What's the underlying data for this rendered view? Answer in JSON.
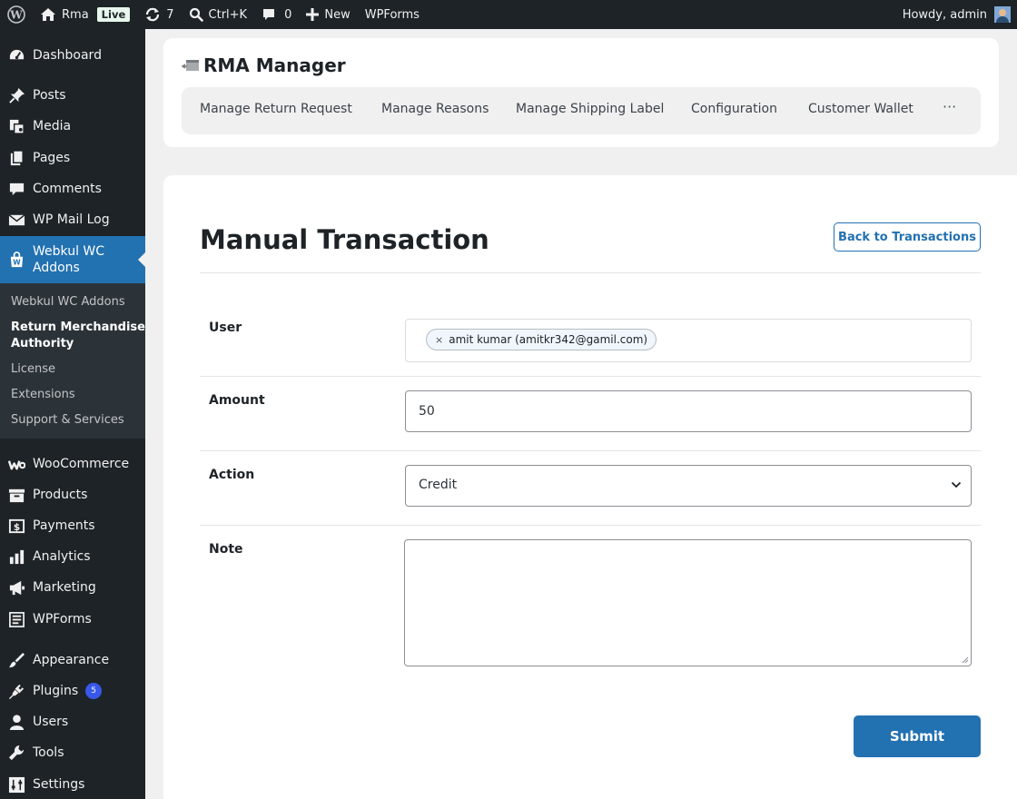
{
  "admin_bar": {
    "site_name": "Rma",
    "live_label": "Live",
    "updates_count": "7",
    "search_shortcut": "Ctrl+K",
    "comments_count": "0",
    "new_label": "New",
    "wpforms_label": "WPForms",
    "greeting": "Howdy, admin"
  },
  "sidebar": {
    "dashboard": "Dashboard",
    "posts": "Posts",
    "media": "Media",
    "pages": "Pages",
    "comments": "Comments",
    "wp_mail_log": "WP Mail Log",
    "webkul_line1": "Webkul WC",
    "webkul_line2": "Addons",
    "submenu": {
      "webkul_wc_addons": "Webkul WC Addons",
      "rma_line1": "Return Merchandise",
      "rma_line2": "Authority",
      "license": "License",
      "extensions": "Extensions",
      "support": "Support & Services"
    },
    "woocommerce": "WooCommerce",
    "products": "Products",
    "payments": "Payments",
    "analytics": "Analytics",
    "marketing": "Marketing",
    "wpforms": "WPForms",
    "appearance": "Appearance",
    "plugins": "Plugins",
    "plugins_badge": "5",
    "users": "Users",
    "tools": "Tools",
    "settings": "Settings"
  },
  "header": {
    "title": "RMA Manager",
    "tabs": {
      "return_request": "Manage Return Request",
      "reasons": "Manage Reasons",
      "shipping_label": "Manage Shipping Label",
      "configuration": "Configuration",
      "customer_wallet": "Customer Wallet",
      "more": "···"
    }
  },
  "form": {
    "page_title": "Manual Transaction",
    "back_button": "Back to Transactions",
    "user_label": "User",
    "user_token_remove": "×",
    "user_value": "amit kumar (amitkr342@gamil.com)",
    "amount_label": "Amount",
    "amount_value": "50",
    "action_label": "Action",
    "action_value": "Credit",
    "note_label": "Note",
    "note_value": "",
    "submit_button": "Submit"
  },
  "colors": {
    "admin_dark": "#1d2327",
    "accent_blue": "#2271b1",
    "live_badge_bg": "#e7f7ed",
    "plugins_badge": "#3858e9"
  }
}
